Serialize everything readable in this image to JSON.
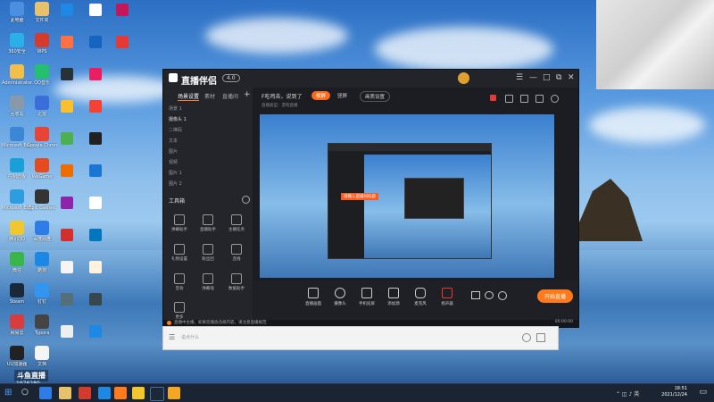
{
  "desktop": {
    "icons_col1": [
      "此电脑",
      "360安全",
      "Administrator",
      "回收站",
      "Microsoft Edge",
      "控制面板",
      "Microsoft Edge",
      "腾讯QQ",
      "微信",
      "Steam",
      "网易云",
      "UU加速器"
    ],
    "icons_col2": [
      "文件夹",
      "WPS",
      "QQ音乐",
      "迅雷",
      "Google Chrome",
      "WeGame",
      "Epic Games",
      "百度网盘",
      "酷狗",
      "钉钉",
      "Typora",
      "文档"
    ]
  },
  "app": {
    "logo": "直播伴侣",
    "badge": "4.0",
    "tabs": [
      "场景设置",
      "素材",
      "直播间"
    ],
    "scenes": [
      "场景 1",
      "摄像头 1",
      "二维码",
      "文本",
      "图片",
      "视频",
      "图片 1",
      "图片 2"
    ],
    "tools_title": "工具箱",
    "tools": [
      "弹幕助手",
      "直播助手",
      "主播任务",
      "礼物设置",
      "粉丝团",
      "连线",
      "音效",
      "弹幕墙",
      "数据助手",
      "更多"
    ],
    "topbar_text": "F吃鸡去，说到了",
    "topbar_pills": [
      "横屏",
      "竖屏",
      "画质设置"
    ],
    "subbar": "直播类型：游戏直播",
    "preview_toast": "请输入直播间标题",
    "controls": [
      "直播画面",
      "摄像头",
      "手机投屏",
      "添加源",
      "麦克风",
      "扬声器"
    ],
    "start_label": "开始直播",
    "status_text": "直播中主播，如果您播放违规内容，请注意直播规范",
    "status_time": "00:00:00"
  },
  "subwin": {
    "placeholder": "说点什么"
  },
  "overlay": {
    "name": "斗鱼直播",
    "room": "1976280"
  },
  "taskbar": {
    "time": "18:51",
    "date": "2021/12/24"
  }
}
